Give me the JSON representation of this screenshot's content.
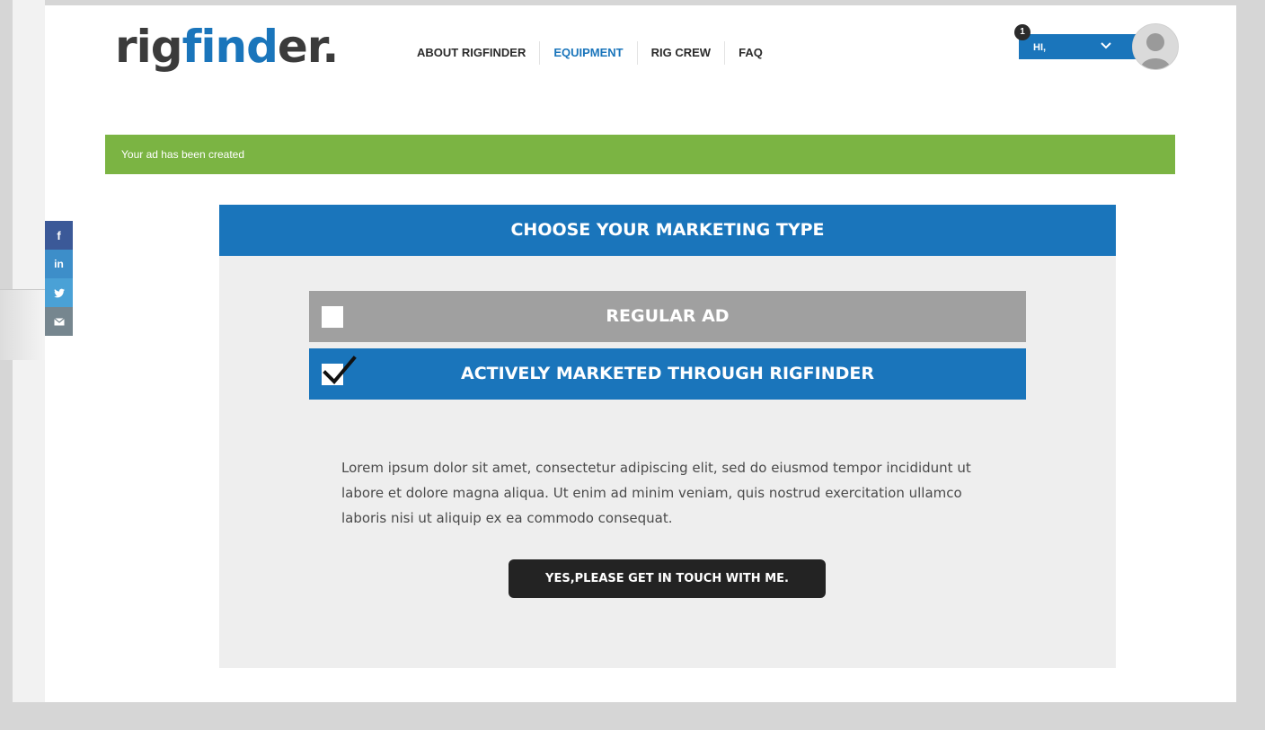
{
  "brand": {
    "logo_part1": "rig",
    "logo_part2": "find",
    "logo_part3": "er."
  },
  "nav": {
    "items": [
      {
        "label": "ABOUT RIGFINDER",
        "active": false
      },
      {
        "label": "EQUIPMENT",
        "active": true
      },
      {
        "label": "RIG CREW",
        "active": false
      },
      {
        "label": "FAQ",
        "active": false
      }
    ]
  },
  "user": {
    "greeting": "HI,",
    "notification_count": "1",
    "chevron_icon": "chevron-down-icon",
    "avatar_icon": "user-avatar-icon"
  },
  "banner": {
    "message": "Your ad has been created"
  },
  "social": {
    "items": [
      {
        "icon": "facebook-icon",
        "glyph": "f"
      },
      {
        "icon": "linkedin-icon",
        "glyph": "in"
      },
      {
        "icon": "twitter-icon",
        "glyph": "t"
      },
      {
        "icon": "email-icon",
        "glyph": "✉"
      }
    ]
  },
  "panel": {
    "title": "CHOOSE YOUR MARKETING TYPE",
    "options": [
      {
        "label": "REGULAR AD",
        "checked": false
      },
      {
        "label": "ACTIVELY MARKETED THROUGH RIGFINDER",
        "checked": true
      }
    ],
    "description": "Lorem ipsum dolor sit amet, consectetur adipiscing elit, sed do eiusmod tempor incididunt ut labore et dolore magna aliqua. Ut enim ad minim veniam, quis nostrud exercitation ullamco laboris nisi ut aliquip ex ea commodo consequat.",
    "cta_label": "YES,PLEASE GET IN TOUCH WITH ME."
  },
  "colors": {
    "primary_blue": "#1a75bb",
    "success_green": "#7bb443",
    "option_gray": "#a0a0a0",
    "panel_bg": "#eeeeee",
    "cta_dark": "#232323"
  }
}
